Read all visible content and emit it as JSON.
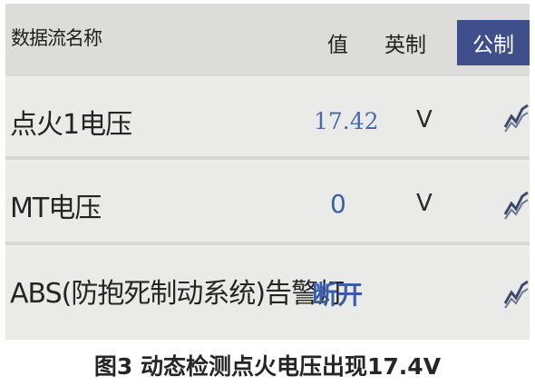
{
  "header": {
    "name_col": "数据流名称",
    "value_col": "值",
    "imperial_tab": "英制",
    "metric_tab": "公制"
  },
  "rows": [
    {
      "label": "点火1电压",
      "value": "17.42",
      "unit": "V",
      "icon": "graph-icon"
    },
    {
      "label": "MT电压",
      "value": "0",
      "unit": "V",
      "icon": "graph-icon"
    },
    {
      "label": "ABS(防抱死制动系统)告警灯",
      "value": "断开",
      "unit": "",
      "icon": "graph-icon"
    }
  ],
  "caption": "图3 动态检测点火电压出现17.4V",
  "colors": {
    "metric_tab_bg": "#3e4f8c",
    "value_text": "#4a6cae",
    "panel_bg": "#eaeae8"
  }
}
